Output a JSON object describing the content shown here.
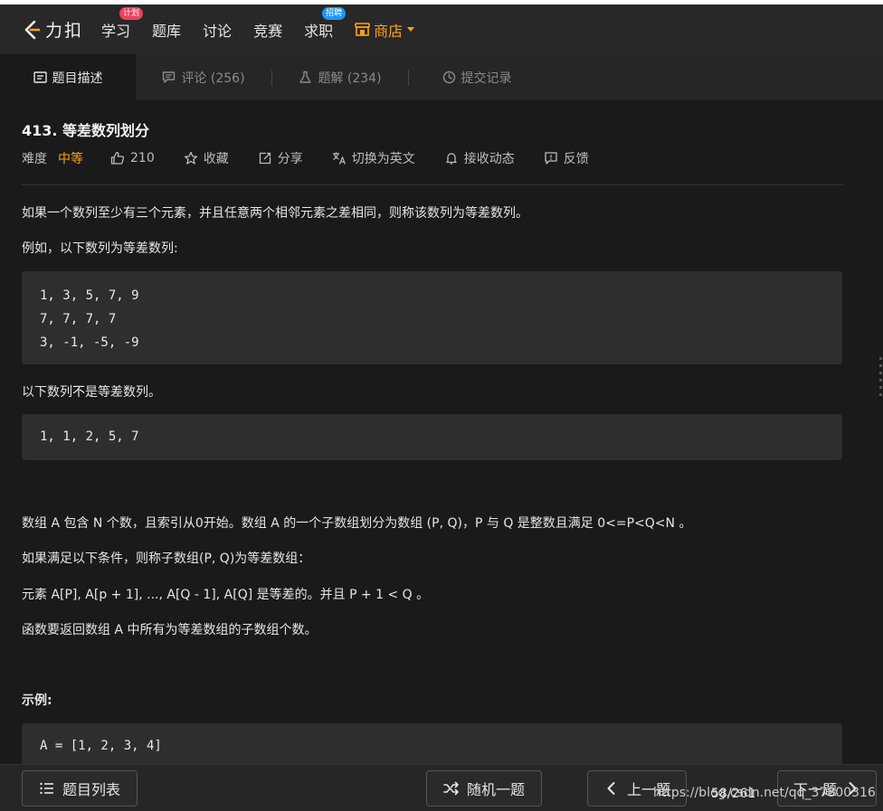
{
  "nav": {
    "logo_text": "力扣",
    "items": [
      {
        "label": "学习",
        "badge": "计划",
        "badge_color": "#e8435a"
      },
      {
        "label": "题库"
      },
      {
        "label": "讨论"
      },
      {
        "label": "竞赛"
      },
      {
        "label": "求职",
        "badge": "招聘",
        "badge_color": "#2196f3"
      }
    ],
    "shop_label": "商店",
    "shop_color": "#ffa116"
  },
  "tabs": [
    {
      "label": "题目描述",
      "icon": "description-icon",
      "active": true
    },
    {
      "label": "评论 (256)",
      "icon": "comment-icon"
    },
    {
      "label": "题解 (234)",
      "icon": "flask-icon"
    },
    {
      "label": "提交记录",
      "icon": "clock-icon"
    }
  ],
  "problem": {
    "title": "413. 等差数列划分",
    "difficulty_label": "难度",
    "difficulty": "中等",
    "difficulty_color": "#ffa116",
    "likes": "210",
    "actions": [
      "收藏",
      "分享",
      "切换为英文",
      "接收动态",
      "反馈"
    ]
  },
  "description": {
    "p1": "如果一个数列至少有三个元素，并且任意两个相邻元素之差相同，则称该数列为等差数列。",
    "p2": "例如，以下数列为等差数列:",
    "code1": [
      "1, 3, 5, 7, 9",
      "7, 7, 7, 7",
      "3, -1, -5, -9"
    ],
    "p3": "以下数列不是等差数列。",
    "code2": [
      "1, 1, 2, 5, 7"
    ],
    "p4": "数组 A 包含 N 个数，且索引从0开始。数组 A 的一个子数组划分为数组 (P, Q)，P 与 Q 是整数且满足 0<=P<Q<N 。",
    "p5": "如果满足以下条件，则称子数组(P, Q)为等差数组：",
    "p6": "元素 A[P], A[p + 1], ..., A[Q - 1], A[Q] 是等差的。并且 P + 1 < Q 。",
    "p7": "函数要返回数组 A 中所有为等差数组的子数组个数。",
    "example_heading": "示例:",
    "code3": [
      "A = [1, 2, 3, 4]"
    ]
  },
  "bottom": {
    "problem_list": "题目列表",
    "random": "随机一题",
    "prev": "上一题",
    "pager": "58/261",
    "next": "下一题",
    "watermark": "https://blog.csdn.net/qq_37800316"
  }
}
